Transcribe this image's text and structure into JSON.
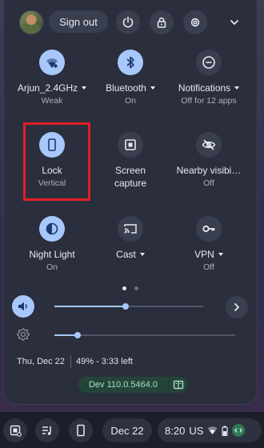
{
  "header": {
    "sign_out_label": "Sign out"
  },
  "tiles": [
    {
      "label": "Arjun_2.4GHz",
      "sub": "Weak",
      "icon": "wifi-icon",
      "on": true
    },
    {
      "label": "Bluetooth",
      "sub": "On",
      "icon": "bluetooth-icon",
      "on": true
    },
    {
      "label": "Notifications",
      "sub": "Off for 12 apps",
      "icon": "do-not-disturb-icon",
      "on": false
    },
    {
      "label": "Lock",
      "sub": "Vertical",
      "icon": "rotation-lock-icon",
      "on": true
    },
    {
      "label": "Screen",
      "sub": "capture",
      "icon": "screen-capture-icon",
      "on": false
    },
    {
      "label": "Nearby visibi…",
      "sub": "Off",
      "icon": "nearby-share-off-icon",
      "on": false
    },
    {
      "label": "Night Light",
      "sub": "On",
      "icon": "night-light-icon",
      "on": true
    },
    {
      "label": "Cast",
      "sub": "",
      "icon": "cast-icon",
      "on": false
    },
    {
      "label": "VPN",
      "sub": "Off",
      "icon": "vpn-key-icon",
      "on": false
    }
  ],
  "sliders": {
    "volume_level": 0.48,
    "brightness_level": 0.13
  },
  "footer": {
    "date": "Thu, Dec 22",
    "battery": "49% - 3:33 left",
    "version": "Dev 110.0.5464.0"
  },
  "shelf": {
    "date": "Dec 22",
    "time": "8:20",
    "locale": "US"
  },
  "colors": {
    "accent": "#a8c7fa",
    "panel": "#2b2f3d",
    "highlight": "#e11d24",
    "version_badge": "#24443a"
  }
}
